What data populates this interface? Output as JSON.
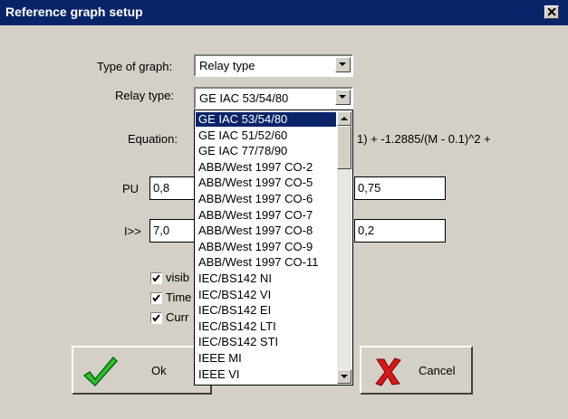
{
  "window": {
    "title": "Reference graph setup"
  },
  "form": {
    "type_of_graph": {
      "label": "Type of graph:",
      "value": "Relay type"
    },
    "relay_type": {
      "label": "Relay type:",
      "value": "GE IAC 53/54/80"
    },
    "equation": {
      "label": "Equation:",
      "text_partial": "1) + -1.2885/(M - 0.1)^2 +"
    },
    "pu": {
      "label": "PU",
      "left_value": "0,8",
      "right_value": "0,75"
    },
    "i_high": {
      "label": "I>>",
      "left_value": "7,0",
      "right_value": "0,2"
    },
    "checkboxes": [
      {
        "label_partial": "visib",
        "checked": true
      },
      {
        "label_partial": "Time",
        "checked": true
      },
      {
        "label_partial": "Curr",
        "checked": true
      }
    ]
  },
  "dropdown": {
    "selected_index": 0,
    "items": [
      "GE IAC 53/54/80",
      "GE IAC 51/52/60",
      "GE IAC 77/78/90",
      "ABB/West 1997 CO-2",
      "ABB/West 1997 CO-5",
      "ABB/West 1997 CO-6",
      "ABB/West 1997 CO-7",
      "ABB/West 1997 CO-8",
      "ABB/West 1997 CO-9",
      "ABB/West 1997 CO-11",
      "IEC/BS142 NI",
      "IEC/BS142 VI",
      "IEC/BS142 EI",
      "IEC/BS142 LTI",
      "IEC/BS142 STI",
      "IEEE MI",
      "IEEE VI"
    ]
  },
  "buttons": {
    "ok": "Ok",
    "cancel": "Cancel"
  },
  "icons": {
    "ok": "green-checkmark-icon",
    "cancel": "red-x-icon",
    "close": "close-icon",
    "dropdown_arrow": "chevron-down-icon"
  },
  "colors": {
    "titlebar": "#0a246a",
    "face": "#d4d0c8",
    "ok_icon": "#2fc02f",
    "cancel_icon": "#d81818"
  }
}
